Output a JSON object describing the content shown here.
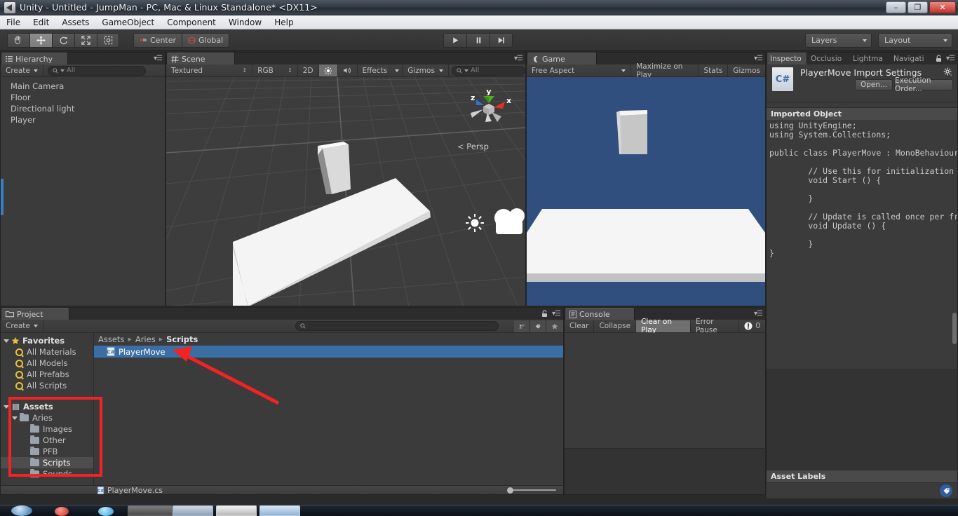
{
  "window": {
    "title": "Unity - Untitled - JumpMan - PC, Mac & Linux Standalone* <DX11>",
    "minimize": "–",
    "restore": "❐",
    "close": "✕",
    "app_icon": "unity-icon"
  },
  "menubar": {
    "items": [
      "File",
      "Edit",
      "Assets",
      "GameObject",
      "Component",
      "Window",
      "Help"
    ]
  },
  "toolbar": {
    "tools": [
      {
        "name": "hand-tool",
        "glyph": "✋",
        "active": false
      },
      {
        "name": "move-tool",
        "glyph": "✥",
        "active": true
      },
      {
        "name": "rotate-tool",
        "glyph": "↻",
        "active": false
      },
      {
        "name": "scale-tool",
        "glyph": "⤡",
        "active": false
      },
      {
        "name": "rect-tool",
        "glyph": "▣",
        "active": false
      }
    ],
    "pivot_label": "Center",
    "handle_label": "Global",
    "play": "▶",
    "pause": "❙❙",
    "step": "▶│",
    "layers_label": "Layers",
    "layout_label": "Layout"
  },
  "hierarchy": {
    "tab": "Hierarchy",
    "create_label": "Create",
    "search_placeholder": "All",
    "items": [
      "Main Camera",
      "Floor",
      "Directional light",
      "Player"
    ]
  },
  "scene": {
    "tab": "Scene",
    "draw_mode": "Textured",
    "color_mode": "RGB",
    "toggle_2d": "2D",
    "light_toggle": "☀",
    "audio_toggle": "⦠",
    "effects_label": "Effects",
    "gizmos_label": "Gizmos",
    "search_placeholder": "All",
    "axis_x": "x",
    "axis_y": "y",
    "axis_z": "z",
    "persp_label": "Persp"
  },
  "game": {
    "tab": "Game",
    "aspect_label": "Free Aspect",
    "maximize_label": "Maximize on Play",
    "stats_label": "Stats",
    "gizmos_label": "Gizmos"
  },
  "inspector": {
    "tabs": [
      "Inspecto",
      "Occlusio",
      "Lightma",
      "Navigati"
    ],
    "active_tab_index": 0,
    "lock_icon": "lock-icon",
    "asset_title": "PlayerMove Import Settings",
    "asset_icon_label": "C#",
    "gear_icon": "gear-icon",
    "open_button": "Open...",
    "execution_order_button": "Execution Order...",
    "imported_object_header": "Imported Object",
    "code_lines": [
      "using UnityEngine;",
      "using System.Collections;",
      "",
      "public class PlayerMove : MonoBehaviour {",
      "",
      "        // Use this for initialization",
      "        void Start () {",
      "",
      "        }",
      "",
      "        // Update is called once per frame",
      "        void Update () {",
      "",
      "        }",
      "}"
    ],
    "asset_labels_header": "Asset Labels",
    "label_tag_icon": "tag-icon"
  },
  "project": {
    "tab": "Project",
    "create_label": "Create",
    "search_placeholder": "",
    "lock_icon": "lock-icon",
    "breadcrumb": [
      "Assets",
      "Aries",
      "Scripts"
    ],
    "breadcrumb_separator": "▶",
    "favorites_label": "Favorites",
    "favorites": [
      "All Materials",
      "All Models",
      "All Prefabs",
      "All Scripts"
    ],
    "assets_label": "Assets",
    "tree": [
      {
        "label": "Aries",
        "depth": 1,
        "selected": false
      },
      {
        "label": "Images",
        "depth": 2,
        "selected": false
      },
      {
        "label": "Other",
        "depth": 2,
        "selected": false
      },
      {
        "label": "PFB",
        "depth": 2,
        "selected": false
      },
      {
        "label": "Scripts",
        "depth": 2,
        "selected": true
      },
      {
        "label": "Sounds",
        "depth": 2,
        "selected": false
      }
    ],
    "files": [
      {
        "name": "PlayerMove",
        "icon": "csharp-script-icon",
        "selected": true
      }
    ],
    "status_file": "PlayerMove.cs",
    "zoom_slider_value": 0
  },
  "console": {
    "tab": "Console",
    "clear_label": "Clear",
    "collapse_label": "Collapse",
    "clear_on_play_label": "Clear on Play",
    "error_pause_label": "Error Pause",
    "error_count": "0"
  },
  "annotation": {
    "highlight_color": "#f42222",
    "arrow_color": "#f42222",
    "arrow_target": "PlayerMove",
    "box_target": "Assets folder tree"
  },
  "colors": {
    "accent_selection": "#3a6ea5",
    "panel_bg": "#3b3b3b",
    "scene_bg": "#3d3d3d",
    "game_bg": "#314f7e",
    "text": "#c2c2c2"
  }
}
